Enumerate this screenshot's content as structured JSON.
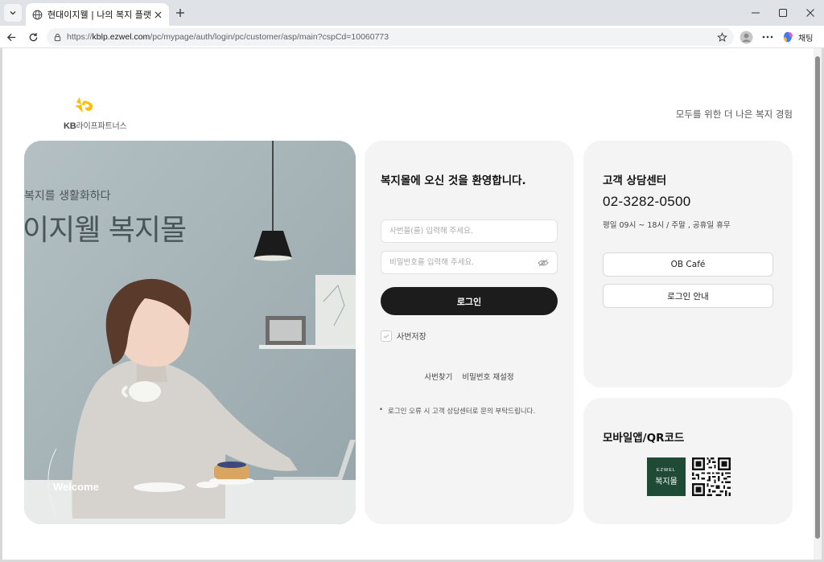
{
  "browser": {
    "tab_title": "현대이지웰 | 나의 복지 플랫폼",
    "url_scheme": "https://",
    "url_host": "kblp.ezwel.com",
    "url_path": "/pc/mypage/auth/login/pc/customer/asp/main?cspCd=10060773",
    "copilot_label": "채팅"
  },
  "header": {
    "logo_brand": "KB",
    "logo_text": "라이프파트너스",
    "tagline": "모두를 위한 더 나은 복지 경험"
  },
  "hero": {
    "subtitle": "복지를 생활화하다",
    "title": "이지웰 복지몰",
    "welcome": "Welcome"
  },
  "login": {
    "title": "복지몰에 오신 것을 환영합니다.",
    "id_placeholder": "사번을(를) 입력해 주세요.",
    "pw_placeholder": "비밀번호를 입력해 주세요.",
    "login_button": "로그인",
    "save_id_label": "사번저장",
    "find_id": "사번찾기",
    "reset_password": "비밀번호 재설정",
    "notice": "로그인 오류 시 고객 상담센터로 문의 부탁드립니다."
  },
  "customer_center": {
    "title": "고객 상담센터",
    "phone": "02-3282-0500",
    "hours": "평일 09시 ~ 18시 / 주말 , 공휴일 휴무",
    "cafe_button": "OB Café",
    "guide_button": "로그인 안내"
  },
  "mobile_app": {
    "title": "모바일앱/QR코드",
    "badge_small": "EZWEL",
    "badge_big": "복지몰"
  },
  "colors": {
    "accent_dark": "#1c1c1c",
    "kb_yellow": "#ffbc00",
    "app_green": "#1f4a36",
    "card_bg": "#f4f4f4"
  }
}
